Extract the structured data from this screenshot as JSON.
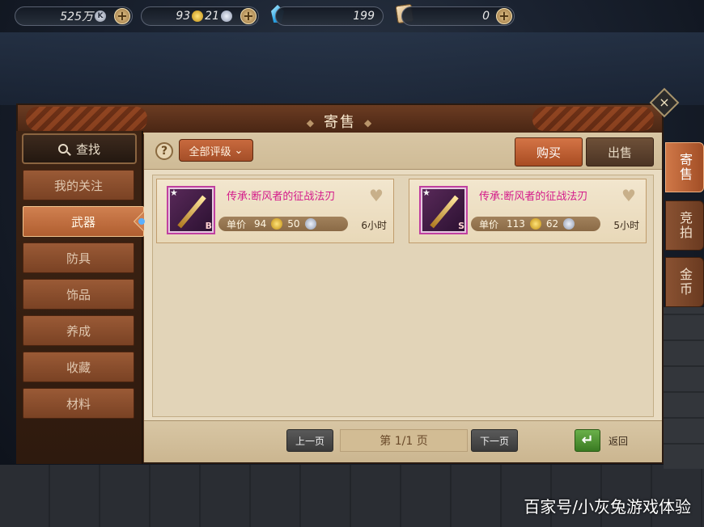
{
  "top_bar": {
    "silver_amount": "525万",
    "silver_unit_icon": "K",
    "gold_amount": "93",
    "silver_small_amount": "21",
    "gem_amount": "199",
    "ticket_amount": "0"
  },
  "panel": {
    "title": "寄售",
    "close_label": "×"
  },
  "sidebar": {
    "search_label": "查找",
    "items": [
      {
        "label": "我的关注"
      },
      {
        "label": "武器"
      },
      {
        "label": "防具"
      },
      {
        "label": "饰品"
      },
      {
        "label": "养成"
      },
      {
        "label": "收藏"
      },
      {
        "label": "材料"
      }
    ],
    "active": "武器"
  },
  "toolbar": {
    "help_label": "?",
    "grade_filter": "全部评级",
    "buy_label": "购买",
    "sell_label": "出售"
  },
  "listings": [
    {
      "name": "传承:断风者的征战法刃",
      "price_label": "单价",
      "gold": "94",
      "silver": "50",
      "time": "6小时",
      "grade_badge": "B"
    },
    {
      "name": "传承:断风者的征战法刃",
      "price_label": "单价",
      "gold": "113",
      "silver": "62",
      "time": "5小时",
      "grade_badge": "S"
    }
  ],
  "pager": {
    "prev_label": "上一页",
    "page_label": "第 1/1 页",
    "next_label": "下一页",
    "return_label": "返回"
  },
  "right_tabs": [
    {
      "label": "寄售",
      "active": true
    },
    {
      "label": "竞拍",
      "active": false
    },
    {
      "label": "金币",
      "active": false
    }
  ],
  "watermark": "百家号/小灰兔游戏体验",
  "colors": {
    "item_name": "#d41a8a",
    "active_tab": "#d07848"
  }
}
